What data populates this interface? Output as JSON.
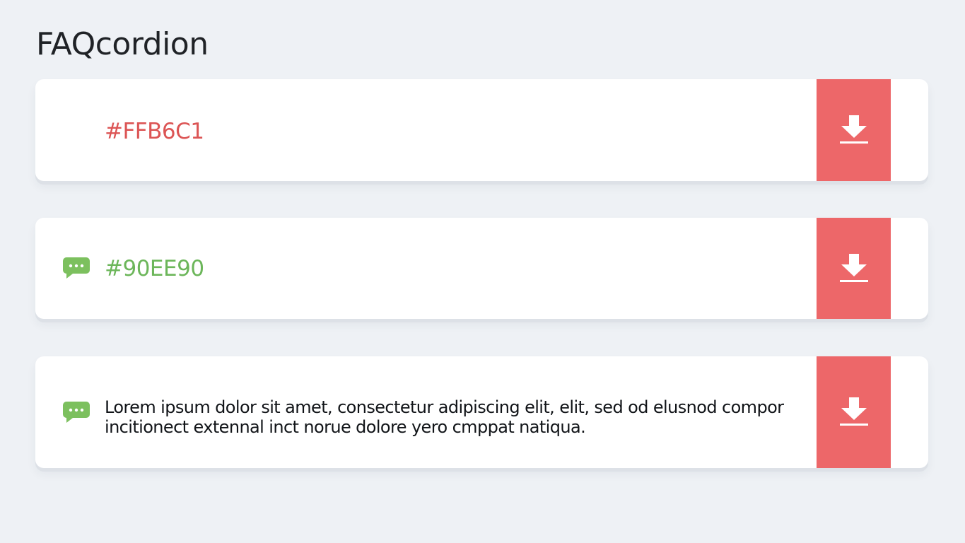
{
  "page": {
    "title": "FAQcordion"
  },
  "colors": {
    "background": "#eef1f5",
    "card": "#ffffff",
    "download_button": "#ed6769",
    "item_1_text": "#dc5555",
    "item_2_text": "#6cb65a",
    "chat_icon": "#7cc05e"
  },
  "items": [
    {
      "label": "#FFB6C1",
      "icon": "none",
      "action_icon": "download-icon"
    },
    {
      "label": "#90EE90",
      "icon": "chat-bubble-icon",
      "action_icon": "download-icon"
    },
    {
      "text": "Lorem ipsum dolor sit amet, consectetur adipiscing elit, elit, sed od elusnod compor incitionect extennal inct norue dolore yero cmppat natiqua.",
      "icon": "chat-bubble-icon",
      "action_icon": "download-icon"
    }
  ]
}
